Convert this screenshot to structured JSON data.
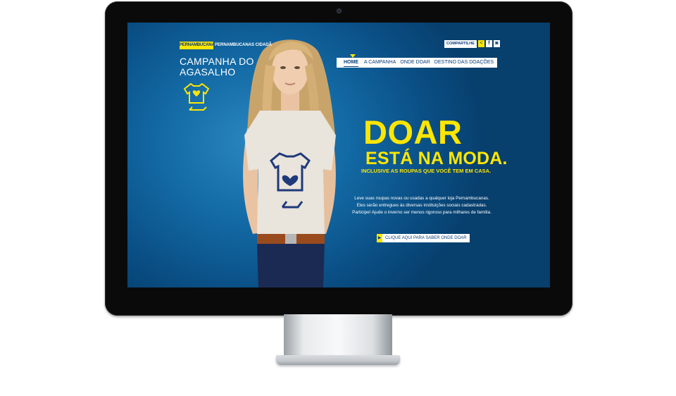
{
  "header": {
    "logo_text": "PERNAMBUCANAS",
    "logo_sub": "PERNAMBUCANAS CIDADÃ",
    "campaign_title": "CAMPANHA DO AGASALHO"
  },
  "share": {
    "label": "COMPARTILHE",
    "icons": [
      "share-icon",
      "facebook-icon",
      "instagram-icon"
    ]
  },
  "nav": {
    "items": [
      "HOME",
      "A CAMPANHA",
      "ONDE DOAR",
      "DESTINO DAS DOAÇÕES"
    ],
    "active": "HOME"
  },
  "hero": {
    "line1": "DOAR",
    "line2": "ESTÁ NA MODA.",
    "line3": "INCLUSIVE AS ROUPAS QUE VOCÊ TEM EM CASA."
  },
  "body": {
    "line1": "Leve suas roupas novas ou usadas a qualquer loja Pernambucanas.",
    "line2": "Eles serão entregues às diversas instituições sociais cadastradas.",
    "line3": "Participe! Ajude o inverno ser menos rigoroso para milhares de família."
  },
  "cta": {
    "label": "CLIQUE AQUI PARA SABER ONDE DOAR"
  },
  "colors": {
    "brand_blue": "#0a3c78",
    "accent_yellow": "#ffe600",
    "background_blue": "#136aa5"
  }
}
